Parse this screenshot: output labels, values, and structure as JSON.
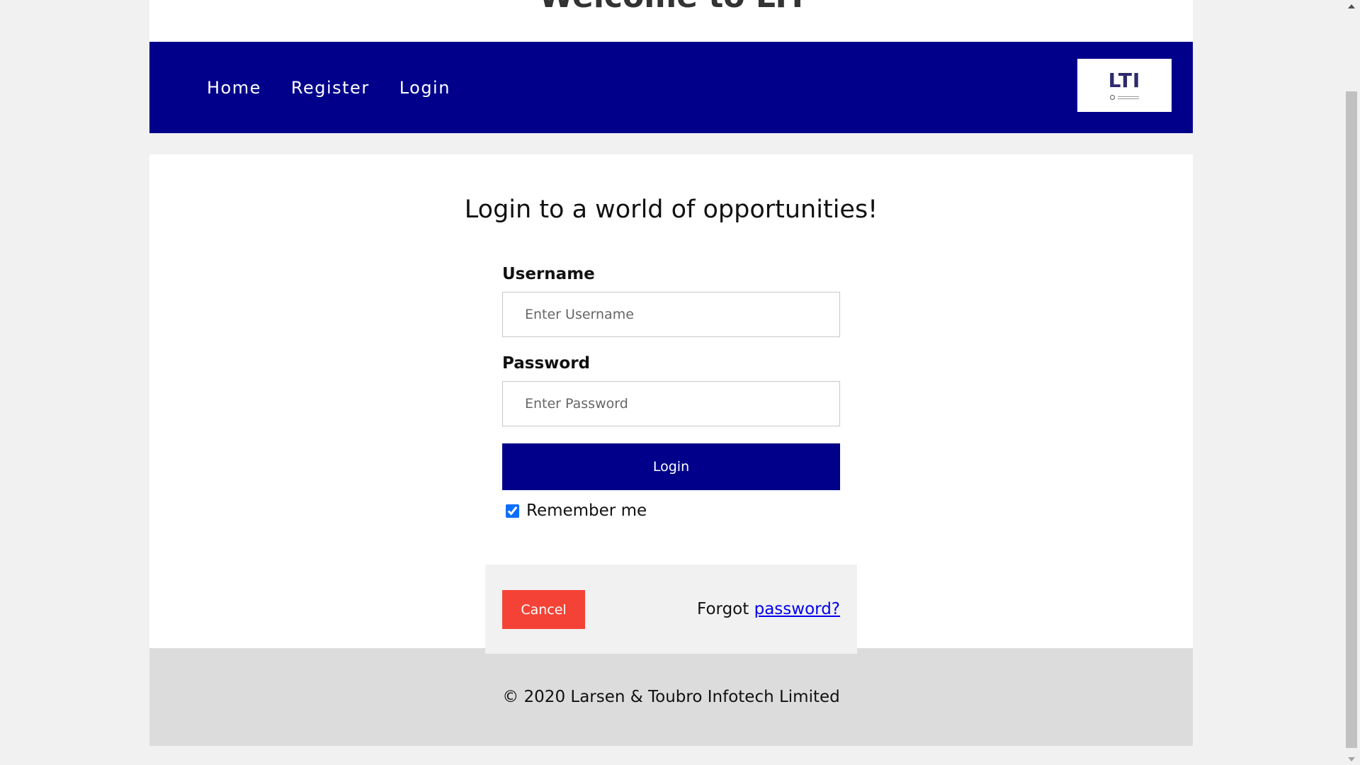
{
  "page": {
    "heading": "Welcome to LTI"
  },
  "nav": {
    "items": [
      {
        "label": "Home"
      },
      {
        "label": "Register"
      },
      {
        "label": "Login"
      }
    ],
    "logo_text": "LTI"
  },
  "login_form": {
    "title": "Login to a world of opportunities!",
    "username_label": "Username",
    "username_placeholder": "Enter Username",
    "password_label": "Password",
    "password_placeholder": "Enter Password",
    "login_button": "Login",
    "remember_label": "Remember me",
    "remember_checked": true,
    "cancel_button": "Cancel",
    "forgot_prefix": "Forgot ",
    "forgot_link": "password?"
  },
  "footer": {
    "copyright": "© 2020 Larsen & Toubro Infotech Limited"
  },
  "colors": {
    "nav_bg": "#00008b",
    "cancel_bg": "#f44336",
    "link": "#0000ee"
  }
}
